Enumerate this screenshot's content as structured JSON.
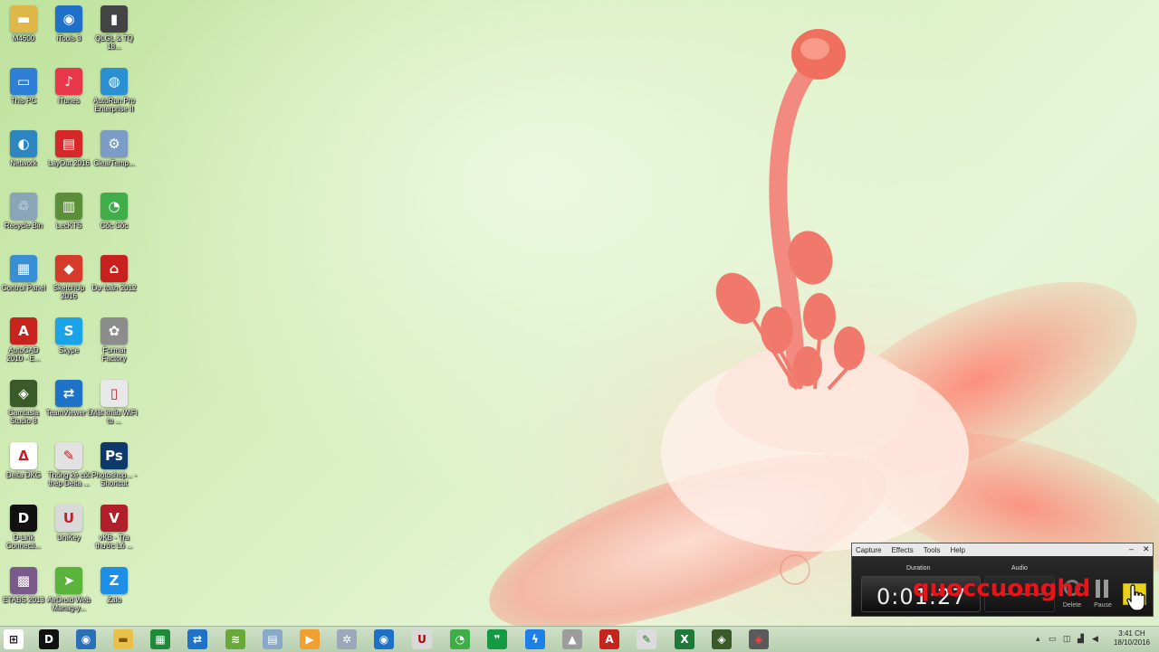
{
  "desktop_icons": [
    {
      "label": "M4600",
      "icon": "folder-icon",
      "color": "#e0b84a",
      "glyph": "▬"
    },
    {
      "label": "iTools 3",
      "icon": "itools-icon",
      "color": "#1e70c9",
      "glyph": "◉"
    },
    {
      "label": "QLGL & TQ 18...",
      "icon": "document-icon",
      "color": "#444444",
      "glyph": "▮"
    },
    {
      "label": "This PC",
      "icon": "computer-icon",
      "color": "#2f7fd6",
      "glyph": "▭"
    },
    {
      "label": "iTunes",
      "icon": "itunes-icon",
      "color": "#e8364a",
      "glyph": "♪"
    },
    {
      "label": "AutoRun Pro Enterprise II",
      "icon": "globe-icon",
      "color": "#2a8fd3",
      "glyph": "◍"
    },
    {
      "label": "Network",
      "icon": "network-icon",
      "color": "#2e86c1",
      "glyph": "◐"
    },
    {
      "label": "LayOut 2016",
      "icon": "layout-icon",
      "color": "#d62828",
      "glyph": "▤"
    },
    {
      "label": "ClearTemp...",
      "icon": "gear-icon",
      "color": "#7a9cc6",
      "glyph": "⚙"
    },
    {
      "label": "Recycle Bin",
      "icon": "recycle-bin-icon",
      "color": "#8aa4b8",
      "glyph": "♲"
    },
    {
      "label": "LecKTS",
      "icon": "chart-icon",
      "color": "#5b8f3a",
      "glyph": "▥"
    },
    {
      "label": "Cốc Cốc",
      "icon": "coccoc-icon",
      "color": "#3fae49",
      "glyph": "◔"
    },
    {
      "label": "Control Panel",
      "icon": "control-panel-icon",
      "color": "#3a8ed4",
      "glyph": "▦"
    },
    {
      "label": "SketchUp 2016",
      "icon": "sketchup-icon",
      "color": "#d63a2a",
      "glyph": "◆"
    },
    {
      "label": "Dự toán 2012",
      "icon": "house-icon",
      "color": "#c8201c",
      "glyph": "⌂"
    },
    {
      "label": "AutoCAD 2010 - E...",
      "icon": "autocad-icon",
      "color": "#c8241e",
      "glyph": "A"
    },
    {
      "label": "Skype",
      "icon": "skype-icon",
      "color": "#1aa3e8",
      "glyph": "S"
    },
    {
      "label": "Format Factory",
      "icon": "format-factory-icon",
      "color": "#8c8c8c",
      "glyph": "✿"
    },
    {
      "label": "Camtasia Studio 8",
      "icon": "camtasia-icon",
      "color": "#3a5a2a",
      "glyph": "◈"
    },
    {
      "label": "TeamViewer 8",
      "icon": "teamviewer-icon",
      "color": "#1e72c8",
      "glyph": "⇄"
    },
    {
      "label": "Mật khẩu WiFi tu ...",
      "icon": "text-file-icon",
      "color": "#e8e8e8",
      "glyph": "▯"
    },
    {
      "label": "Delta DKG",
      "icon": "delta-icon",
      "color": "#ffffff",
      "glyph": "Δ"
    },
    {
      "label": "Thống kê cốt thép Delta ...",
      "icon": "pen-icon",
      "color": "#e2e2e2",
      "glyph": "✎"
    },
    {
      "label": "Photoshop... - Shortcut",
      "icon": "photoshop-icon",
      "color": "#0d3a6b",
      "glyph": "Ps"
    },
    {
      "label": "D-Link Connecti...",
      "icon": "dlink-icon",
      "color": "#111111",
      "glyph": "D"
    },
    {
      "label": "UniKey",
      "icon": "unikey-icon",
      "color": "#d9d9d9",
      "glyph": "U"
    },
    {
      "label": "vKB - Tra thước Lỗ ...",
      "icon": "vkb-icon",
      "color": "#b0202a",
      "glyph": "V"
    },
    {
      "label": "ETABS 2013",
      "icon": "etabs-icon",
      "color": "#7a5a8a",
      "glyph": "▩"
    },
    {
      "label": "AirDroid Web Manag-y...",
      "icon": "airdroid-icon",
      "color": "#5ab43c",
      "glyph": "➤"
    },
    {
      "label": "Zalo",
      "icon": "zalo-icon",
      "color": "#1d8fe8",
      "glyph": "Z"
    }
  ],
  "recorder": {
    "menu": [
      "Capture",
      "Effects",
      "Tools",
      "Help"
    ],
    "minimize": "–",
    "close": "✕",
    "duration_label": "Duration",
    "duration_value": "0:01:27",
    "audio_label": "Audio",
    "delete_label": "Delete",
    "pause_label": "Pause"
  },
  "watermark": "quoccuonghd",
  "taskbar": {
    "items": [
      {
        "icon": "start-icon",
        "glyph": "⊞",
        "color": "#ffffff",
        "fg": "#1a1a1a"
      },
      {
        "icon": "dlink-taskbar-icon",
        "glyph": "D",
        "color": "#111111",
        "fg": "#ffffff"
      },
      {
        "icon": "vista-icon",
        "glyph": "◉",
        "color": "#2a6fb8",
        "fg": "#ffffff"
      },
      {
        "icon": "file-explorer-icon",
        "glyph": "▬",
        "color": "#e8c04a",
        "fg": "#7a5a10"
      },
      {
        "icon": "project-icon",
        "glyph": "▦",
        "color": "#1e8a3a",
        "fg": "#ffffff"
      },
      {
        "icon": "teamviewer-taskbar-icon",
        "glyph": "⇄",
        "color": "#1e72c8",
        "fg": "#ffffff"
      },
      {
        "icon": "wifi-icon",
        "glyph": "≋",
        "color": "#6aa83a",
        "fg": "#ffffff"
      },
      {
        "icon": "calculator-icon",
        "glyph": "▤",
        "color": "#8aa8c8",
        "fg": "#ffffff"
      },
      {
        "icon": "media-player-icon",
        "glyph": "▶",
        "color": "#f0a030",
        "fg": "#ffffff"
      },
      {
        "icon": "settings-tool-icon",
        "glyph": "✲",
        "color": "#9aa8b8",
        "fg": "#ffffff"
      },
      {
        "icon": "itools-taskbar-icon",
        "glyph": "◉",
        "color": "#1e70c9",
        "fg": "#ffffff"
      },
      {
        "icon": "unikey-taskbar-icon",
        "glyph": "U",
        "color": "#d9d9d9",
        "fg": "#b00000"
      },
      {
        "icon": "coccoc-taskbar-icon",
        "glyph": "◔",
        "color": "#3fae49",
        "fg": "#ffffff"
      },
      {
        "icon": "hangouts-icon",
        "glyph": "❞",
        "color": "#139a43",
        "fg": "#ffffff"
      },
      {
        "icon": "messenger-icon",
        "glyph": "ϟ",
        "color": "#1d7fe8",
        "fg": "#ffffff"
      },
      {
        "icon": "autorun-taskbar-icon",
        "glyph": "▲",
        "color": "#9c9c9c",
        "fg": "#ffffff"
      },
      {
        "icon": "acad-taskbar-icon",
        "glyph": "A",
        "color": "#c8241e",
        "fg": "#ffffff"
      },
      {
        "icon": "pen-taskbar-icon",
        "glyph": "✎",
        "color": "#dcdcdc",
        "fg": "#2a7a2a"
      },
      {
        "icon": "excel-icon",
        "glyph": "X",
        "color": "#1f7a3a",
        "fg": "#ffffff"
      },
      {
        "icon": "camtasia-taskbar-icon",
        "glyph": "◈",
        "color": "#3a5a2a",
        "fg": "#ffffff"
      },
      {
        "icon": "recorder-taskbar-icon",
        "glyph": "◈",
        "color": "#5a5a5a",
        "fg": "#ff4040"
      }
    ],
    "clock_time": "3:41 CH",
    "clock_date": "18/10/2016"
  }
}
